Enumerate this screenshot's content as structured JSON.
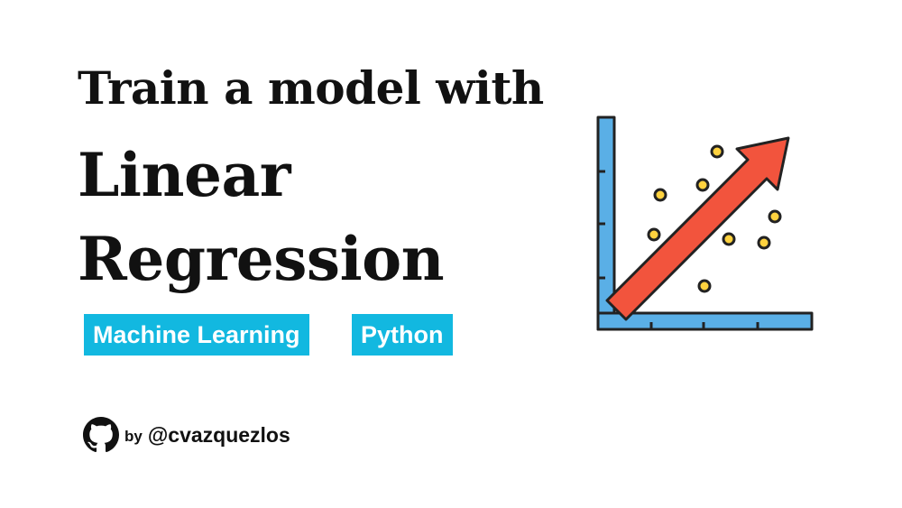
{
  "title": {
    "line1": "Train a model with",
    "line2": "Linear",
    "line3": "Regression"
  },
  "tags": [
    {
      "label": "Machine Learning"
    },
    {
      "label": "Python"
    }
  ],
  "author": {
    "by": "by",
    "handle": "@cvazquezlos",
    "icon": "github-icon"
  },
  "illustration": {
    "icon": "linear-regression-chart-icon",
    "colors": {
      "axis": "#5aafe6",
      "arrow": "#f2543d",
      "points": "#ffd23f",
      "outline": "#222222",
      "tag_background": "#12b8e0"
    }
  }
}
